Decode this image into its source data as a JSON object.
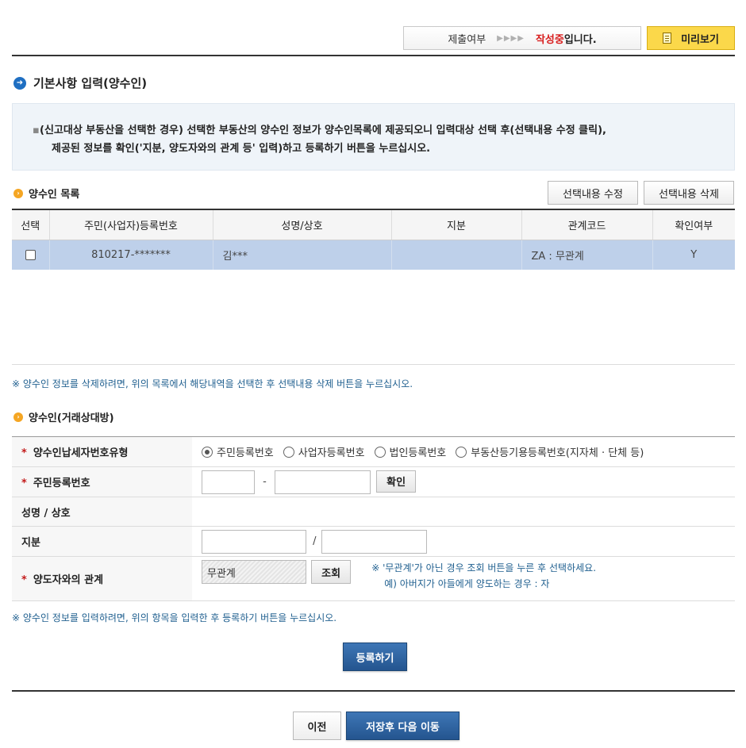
{
  "status": {
    "label": "제출여부",
    "arrows": "▶▶▶▶",
    "value": "작성중",
    "suffix": "입니다."
  },
  "preview_button": "미리보기",
  "section_title": "기본사항 입력(양수인)",
  "notice": {
    "line1": "(신고대상 부동산을 선택한 경우) 선택한 부동산의 양수인 정보가 양수인목록에 제공되오니 입력대상 선택 후(선택내용 수정 클릭),",
    "line2": "제공된 정보를 확인('지분, 양도자와의 관계 등' 입력)하고 등록하기 버튼을 누르십시오."
  },
  "list": {
    "title": "양수인 목록",
    "edit_button": "선택내용 수정",
    "delete_button": "선택내용 삭제",
    "headers": [
      "선택",
      "주민(사업자)등록번호",
      "성명/상호",
      "지분",
      "관계코드",
      "확인여부"
    ],
    "rows": [
      {
        "id": "810217-*******",
        "name": "김***",
        "share": "",
        "relation": "ZA : 무관계",
        "confirmed": "Y"
      }
    ],
    "delete_note": "※ 양수인 정보를 삭제하려면, 위의 목록에서 해당내역을 선택한 후 선택내용 삭제 버튼을 누르십시오."
  },
  "form": {
    "title": "양수인(거래상대방)",
    "taxid_type_label": "양수인납세자번호유형",
    "taxid_options": [
      "주민등록번호",
      "사업자등록번호",
      "법인등록번호",
      "부동산등기용등록번호(지자체 · 단체 등)"
    ],
    "selected_taxid_option": "주민등록번호",
    "rrn_label": "주민등록번호",
    "rrn_separator": "-",
    "confirm_button": "확인",
    "name_label": "성명 / 상호",
    "share_label": "지분",
    "share_separator": "/",
    "relation_label": "양도자와의 관계",
    "relation_value": "무관계",
    "lookup_button": "조회",
    "relation_note1": "※ '무관계'가 아닌 경우 조회 버튼을 누른 후 선택하세요.",
    "relation_note2": "예) 아버지가 아들에게 양도하는 경우 : 자",
    "input_note": "※ 양수인 정보를 입력하려면, 위의 항목을 입력한 후 등록하기 버튼을 누르십시오.",
    "register_button": "등록하기"
  },
  "footer": {
    "prev_button": "이전",
    "next_button": "저장후 다음 이동"
  }
}
